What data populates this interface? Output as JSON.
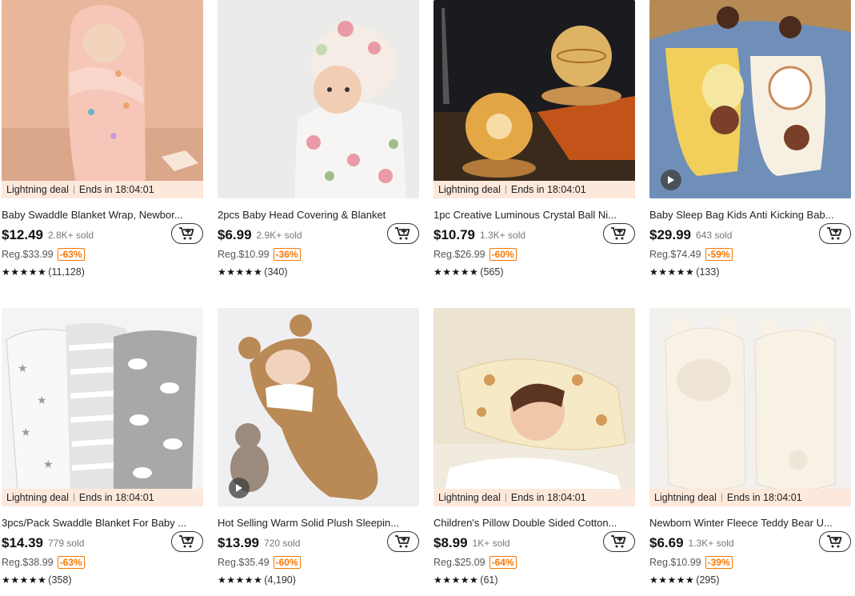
{
  "deal_banner": {
    "label": "Lightning deal",
    "timer": "Ends in 18:04:01"
  },
  "products": [
    {
      "title": "Baby Swaddle Blanket Wrap, Newbor...",
      "price": "$12.49",
      "sold": "2.8K+ sold",
      "reg": "Reg.$33.99",
      "discount": "-63%",
      "rating_stars": "★★★★★",
      "reviews": "(11,128)",
      "has_deal": true,
      "has_video": false,
      "image": "pink-swaddle-blanket"
    },
    {
      "title": "2pcs Baby Head Covering & Blanket",
      "price": "$6.99",
      "sold": "2.9K+ sold",
      "reg": "Reg.$10.99",
      "discount": "-36%",
      "rating_stars": "★★★★★",
      "reviews": "(340)",
      "has_deal": false,
      "has_video": false,
      "image": "floral-baby-wrap"
    },
    {
      "title": "1pc Creative Luminous Crystal Ball Ni...",
      "price": "$10.79",
      "sold": "1.3K+ sold",
      "reg": "Reg.$26.99",
      "discount": "-60%",
      "rating_stars": "★★★★★",
      "reviews": "(565)",
      "has_deal": true,
      "has_video": false,
      "image": "crystal-ball-lamp"
    },
    {
      "title": "Baby Sleep Bag Kids Anti Kicking Bab...",
      "price": "$29.99",
      "sold": "643 sold",
      "reg": "Reg.$74.49",
      "discount": "-59%",
      "rating_stars": "★★★★★",
      "reviews": "(133)",
      "has_deal": false,
      "has_video": true,
      "image": "animal-sleep-bags"
    },
    {
      "title": "3pcs/Pack Swaddle Blanket For Baby ...",
      "price": "$14.39",
      "sold": "779 sold",
      "reg": "Reg.$38.99",
      "discount": "-63%",
      "rating_stars": "★★★★★",
      "reviews": "(358)",
      "has_deal": true,
      "has_video": false,
      "image": "grey-swaddle-pack"
    },
    {
      "title": "Hot Selling Warm Solid Plush Sleepin...",
      "price": "$13.99",
      "sold": "720 sold",
      "reg": "Reg.$35.49",
      "discount": "-60%",
      "rating_stars": "★★★★★",
      "reviews": "(4,190)",
      "has_deal": false,
      "has_video": true,
      "image": "bear-plush-sleeper"
    },
    {
      "title": "Children's Pillow Double Sided Cotton...",
      "price": "$8.99",
      "sold": "1K+ sold",
      "reg": "Reg.$25.09",
      "discount": "-64%",
      "rating_stars": "★★★★★",
      "reviews": "(61)",
      "has_deal": true,
      "has_video": false,
      "image": "kids-pillow"
    },
    {
      "title": "Newborn Winter Fleece Teddy Bear U...",
      "price": "$6.69",
      "sold": "1.3K+ sold",
      "reg": "Reg.$10.99",
      "discount": "-39%",
      "rating_stars": "★★★★★",
      "reviews": "(295)",
      "has_deal": true,
      "has_video": false,
      "image": "white-fleece-bunting"
    }
  ]
}
